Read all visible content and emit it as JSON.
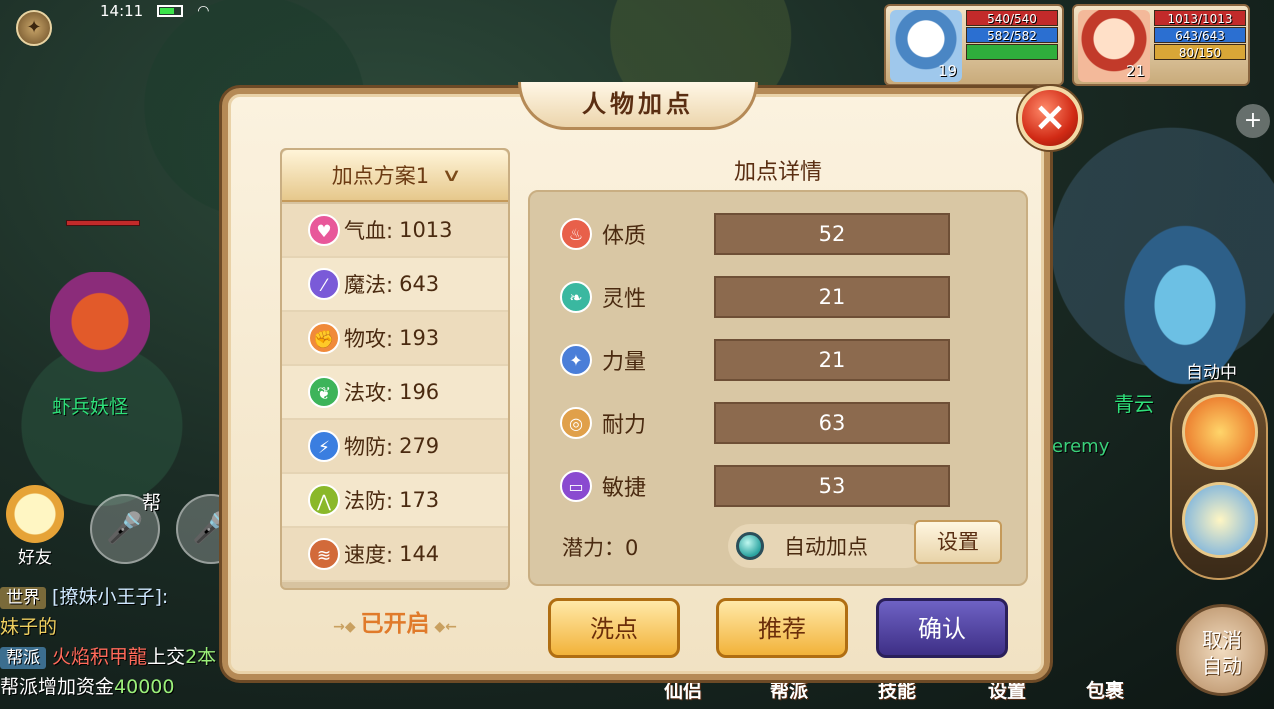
{
  "status": {
    "time": "14:11"
  },
  "party": [
    {
      "hp": "540/540",
      "mp": "582/582",
      "level": "19"
    },
    {
      "hp": "1013/1013",
      "mp": "643/643",
      "sp": "80/150",
      "level": "21"
    }
  ],
  "world": {
    "monster_name": "虾兵妖怪",
    "hero_name": "青云",
    "hero_sub": "eremy",
    "auto_label": "自动中",
    "voice_tag": "帮",
    "friend_label": "好友",
    "cancel_auto": "取消\n自动"
  },
  "chat": [
    {
      "tag": "世界",
      "name": "[撩妹小王子]:",
      "text": "妹子的"
    },
    {
      "tag": "帮派",
      "name": "火焰积甲龍",
      "mid": "上交",
      "num": "2本",
      "text2": "帮派增加资金",
      "amount": "40000"
    }
  ],
  "bottom_menu": [
    "仙侣",
    "帮派",
    "技能",
    "设置",
    "包裹"
  ],
  "dialog": {
    "title": "人物加点",
    "close_icon": "×",
    "scheme_label": "加点方案1",
    "attributes": [
      {
        "label": "气血:",
        "value": "1013",
        "icon": "heart-icon",
        "color": "#e8589a",
        "glyph": "♥"
      },
      {
        "label": "魔法:",
        "value": "643",
        "icon": "magic-icon",
        "color": "#7a5ad8",
        "glyph": "⁄"
      },
      {
        "label": "物攻:",
        "value": "193",
        "icon": "fist-icon",
        "color": "#f08a3a",
        "glyph": "✊"
      },
      {
        "label": "法攻:",
        "value": "196",
        "icon": "leaf-icon",
        "color": "#3db45a",
        "glyph": "❦"
      },
      {
        "label": "物防:",
        "value": "279",
        "icon": "lightning-icon",
        "color": "#3a7ee0",
        "glyph": "⚡"
      },
      {
        "label": "法防:",
        "value": "173",
        "icon": "shield-icon",
        "color": "#8ab82a",
        "glyph": "⋀"
      },
      {
        "label": "速度:",
        "value": "144",
        "icon": "wing-icon",
        "color": "#d26a3a",
        "glyph": "≋"
      }
    ],
    "opened_label": "已开启",
    "detail_title": "加点详情",
    "stats": [
      {
        "label": "体质",
        "value": "52",
        "icon": "body-icon",
        "color": "#e8604a",
        "glyph": "♨"
      },
      {
        "label": "灵性",
        "value": "21",
        "icon": "spirit-icon",
        "color": "#3ab8a0",
        "glyph": "❧"
      },
      {
        "label": "力量",
        "value": "21",
        "icon": "strength-icon",
        "color": "#4a7ed8",
        "glyph": "✦"
      },
      {
        "label": "耐力",
        "value": "63",
        "icon": "endurance-icon",
        "color": "#e0a04a",
        "glyph": "◎"
      },
      {
        "label": "敏捷",
        "value": "53",
        "icon": "agility-icon",
        "color": "#8a4ad0",
        "glyph": "▭"
      }
    ],
    "potential": "潜力：0",
    "auto_add_label": "自动加点",
    "settings_label": "设置",
    "buttons": {
      "reset": "洗点",
      "recommend": "推荐",
      "confirm": "确认"
    }
  }
}
